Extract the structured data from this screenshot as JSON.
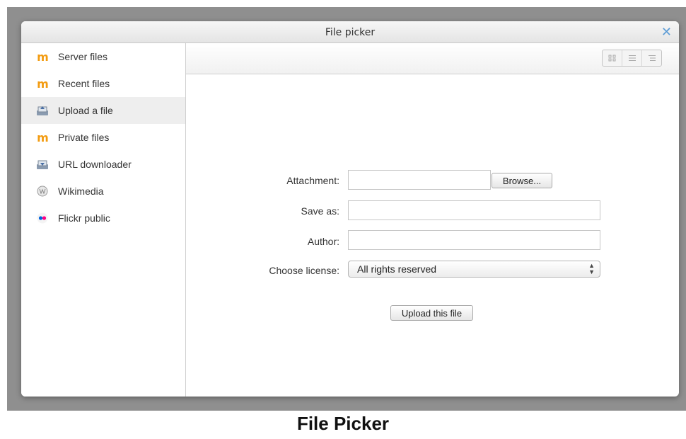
{
  "dialog": {
    "title": "File picker",
    "close_glyph": "✕"
  },
  "sidebar": {
    "items": [
      {
        "label": "Server files",
        "icon": "moodle-icon"
      },
      {
        "label": "Recent files",
        "icon": "moodle-icon"
      },
      {
        "label": "Upload a file",
        "icon": "upload-icon",
        "active": true
      },
      {
        "label": "Private files",
        "icon": "moodle-icon"
      },
      {
        "label": "URL downloader",
        "icon": "url-download-icon"
      },
      {
        "label": "Wikimedia",
        "icon": "wikimedia-icon"
      },
      {
        "label": "Flickr public",
        "icon": "flickr-icon"
      }
    ]
  },
  "toolbar": {
    "views": [
      "icon-view",
      "list-view",
      "tree-view"
    ]
  },
  "form": {
    "attachment_label": "Attachment:",
    "attachment_value": "",
    "browse_label": "Browse...",
    "saveas_label": "Save as:",
    "saveas_value": "",
    "author_label": "Author:",
    "author_value": "",
    "license_label": "Choose license:",
    "license_value": "All rights reserved",
    "upload_label": "Upload this file"
  },
  "caption": "File Picker",
  "colors": {
    "accent": "#5a9bd5",
    "moodle_orange": "#f39c12",
    "backdrop": "#8f8f8f"
  }
}
